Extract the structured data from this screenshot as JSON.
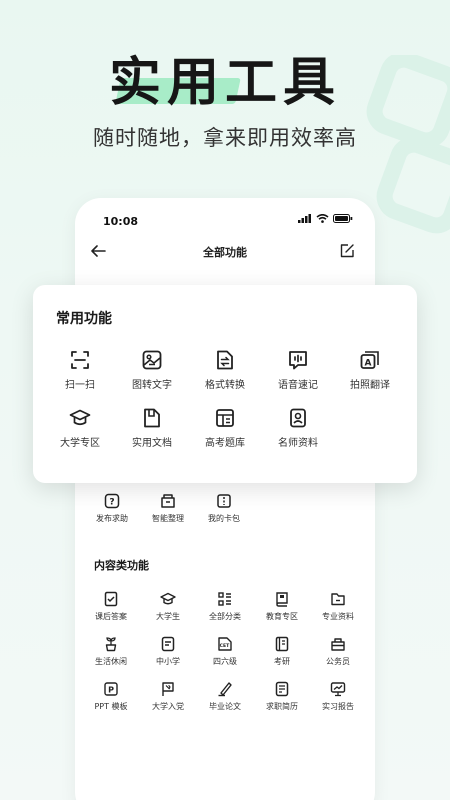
{
  "hero": {
    "title": "实用工具",
    "subtitle": "随时随地，拿来即用效率高"
  },
  "status_bar": {
    "time": "10:08"
  },
  "nav": {
    "title": "全部功能"
  },
  "common": {
    "title": "常用功能",
    "items": [
      {
        "label": "扫一扫",
        "icon": "scan-icon"
      },
      {
        "label": "图转文字",
        "icon": "image-text-icon"
      },
      {
        "label": "格式转换",
        "icon": "format-convert-icon"
      },
      {
        "label": "语音速记",
        "icon": "voice-note-icon"
      },
      {
        "label": "拍照翻译",
        "icon": "photo-translate-icon"
      },
      {
        "label": "大学专区",
        "icon": "graduation-cap-icon"
      },
      {
        "label": "实用文档",
        "icon": "document-icon"
      },
      {
        "label": "高考题库",
        "icon": "question-bank-icon"
      },
      {
        "label": "名师资料",
        "icon": "teacher-material-icon"
      }
    ]
  },
  "misc": {
    "items": [
      {
        "label": "发布求助",
        "icon": "help-icon"
      },
      {
        "label": "智能整理",
        "icon": "organize-icon"
      },
      {
        "label": "我的卡包",
        "icon": "card-wallet-icon"
      }
    ]
  },
  "content": {
    "title": "内容类功能",
    "items": [
      {
        "label": "课后答案",
        "icon": "homework-answer-icon"
      },
      {
        "label": "大学生",
        "icon": "student-cap-icon"
      },
      {
        "label": "全部分类",
        "icon": "category-icon"
      },
      {
        "label": "教育专区",
        "icon": "education-book-icon"
      },
      {
        "label": "专业资料",
        "icon": "folder-icon"
      },
      {
        "label": "生活休闲",
        "icon": "plant-icon"
      },
      {
        "label": "中小学",
        "icon": "school-doc-icon"
      },
      {
        "label": "四六级",
        "icon": "cet-icon"
      },
      {
        "label": "考研",
        "icon": "exam-book-icon"
      },
      {
        "label": "公务员",
        "icon": "civil-servant-icon"
      },
      {
        "label": "PPT 模板",
        "icon": "ppt-icon"
      },
      {
        "label": "大学入党",
        "icon": "party-flag-icon"
      },
      {
        "label": "毕业论文",
        "icon": "thesis-pen-icon"
      },
      {
        "label": "求职简历",
        "icon": "resume-icon"
      },
      {
        "label": "实习报告",
        "icon": "report-icon"
      }
    ]
  },
  "colors": {
    "accent_green": "#a8ecc8",
    "background": "#eaf7f1",
    "icon_stroke": "#222222"
  }
}
